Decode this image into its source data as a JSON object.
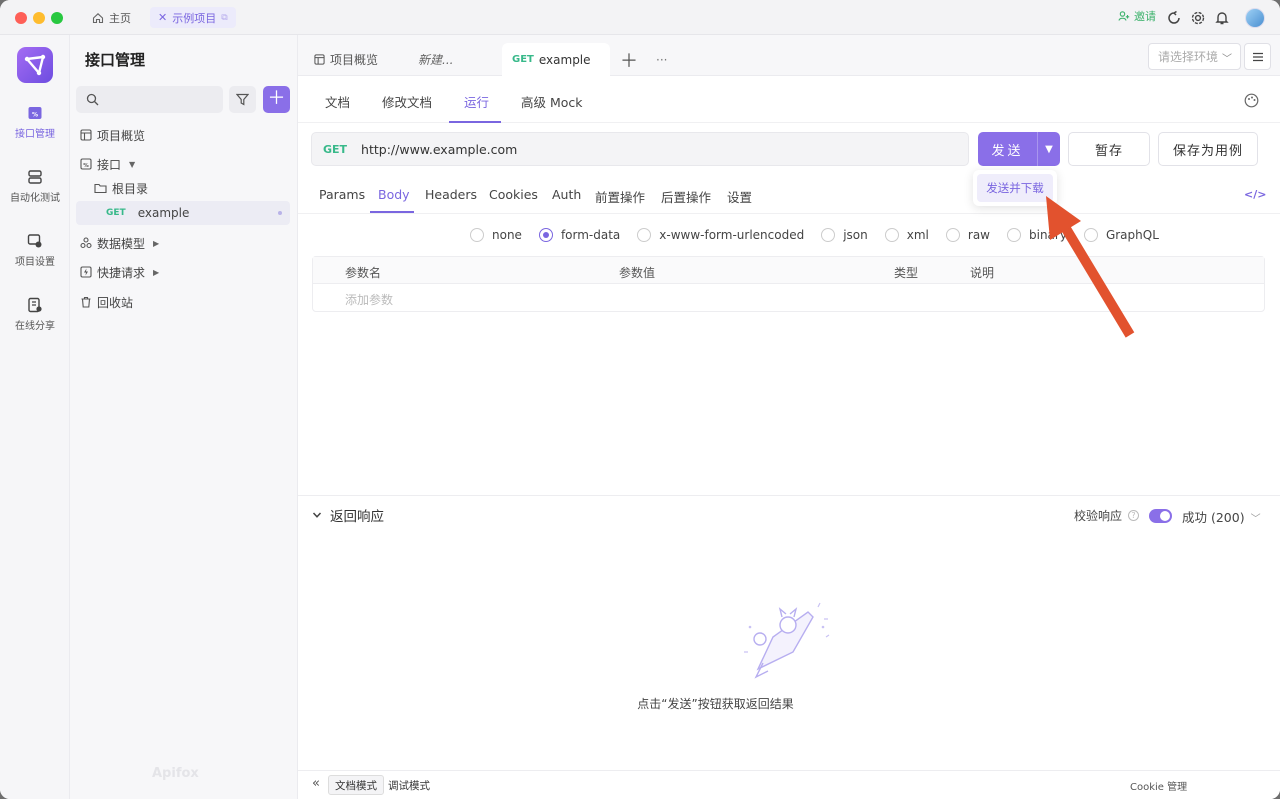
{
  "titlebar": {
    "home_tab": "主页",
    "project_tab": "示例项目",
    "invite": "邀请"
  },
  "rail": {
    "items": [
      {
        "label": "接口管理",
        "icon": "api-icon",
        "active": true
      },
      {
        "label": "自动化测试",
        "icon": "automation-icon",
        "active": false
      },
      {
        "label": "项目设置",
        "icon": "settings-icon",
        "active": false
      },
      {
        "label": "在线分享",
        "icon": "share-icon",
        "active": false
      }
    ]
  },
  "sidebar": {
    "title": "接口管理",
    "tree": {
      "overview": "项目概览",
      "api": "接口",
      "root": "根目录",
      "endpoint_method": "GET",
      "endpoint_name": "example",
      "schemas": "数据模型",
      "quick": "快捷请求",
      "trash": "回收站"
    },
    "watermark": "Apifox"
  },
  "filetabs": {
    "overview": "项目概览",
    "new": "新建...",
    "active_method": "GET",
    "active_name": "example",
    "more": "···"
  },
  "env": {
    "placeholder": "请选择环境"
  },
  "subtabs": [
    "文档",
    "修改文档",
    "运行",
    "高级 Mock"
  ],
  "request": {
    "method": "GET",
    "url": "http://www.example.com",
    "send": "发送",
    "send_download": "发送并下载",
    "save_draft": "暂存",
    "save_as_case": "保存为用例"
  },
  "param_tabs": [
    "Params",
    "Body",
    "Headers",
    "Cookies",
    "Auth",
    "前置操作",
    "后置操作",
    "设置"
  ],
  "body_types": [
    "none",
    "form-data",
    "x-www-form-urlencoded",
    "json",
    "xml",
    "raw",
    "binary",
    "GraphQL"
  ],
  "body_selected": "form-data",
  "param_table": {
    "headers": [
      "参数名",
      "参数值",
      "类型",
      "说明"
    ],
    "add_placeholder": "添加参数"
  },
  "response": {
    "title": "返回响应",
    "validate": "校验响应",
    "status": "成功 (200)",
    "hint": "点击“发送”按钮获取返回结果"
  },
  "bottombar": {
    "doc_mode": "文档模式",
    "debug_mode": "调试模式",
    "cookie": "Cookie 管理"
  },
  "colors": {
    "accent": "#8a6fe8",
    "get_method": "#38b98a",
    "annotation_arrow": "#e2522e"
  }
}
